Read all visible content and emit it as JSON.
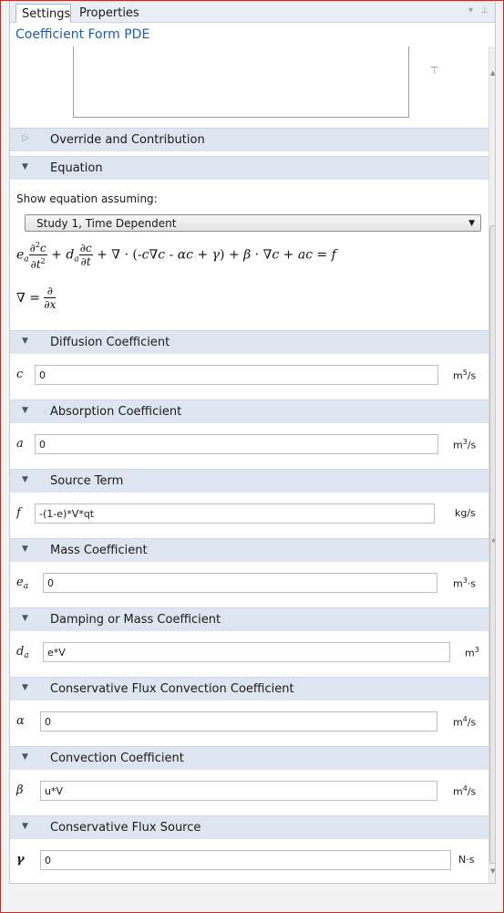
{
  "tabs": [
    {
      "label": "Settings"
    },
    {
      "label": "Properties"
    }
  ],
  "node_title": "Coefficient Form PDE",
  "sections": {
    "override": "Override and Contribution",
    "equation": "Equation",
    "diffusion": "Diffusion Coefficient",
    "absorption": "Absorption Coefficient",
    "source": "Source Term",
    "mass": "Mass Coefficient",
    "damping": "Damping or Mass Coefficient",
    "cflux_conv": "Conservative Flux Convection Coefficient",
    "convection": "Convection Coefficient",
    "cflux_source": "Conservative Flux Source"
  },
  "equation": {
    "show_label": "Show equation assuming:",
    "study_selected": "Study 1, Time Dependent"
  },
  "fields": {
    "c": {
      "symbol": "c",
      "value": "0",
      "unit": "m",
      "unit_sup": "5",
      "unit_tail": "/s"
    },
    "a": {
      "symbol": "a",
      "value": "0",
      "unit": "m",
      "unit_sup": "3",
      "unit_tail": "/s"
    },
    "f": {
      "symbol": "f",
      "value": "-(1-e)*V*qt",
      "unit": "kg/s",
      "unit_sup": "",
      "unit_tail": ""
    },
    "ea": {
      "symbol": "e",
      "sub": "a",
      "value": "0",
      "unit": "m",
      "unit_sup": "3",
      "unit_tail": "·s"
    },
    "da": {
      "symbol": "d",
      "sub": "a",
      "value": "e*V",
      "unit": "m",
      "unit_sup": "3",
      "unit_tail": ""
    },
    "alpha": {
      "symbol": "α",
      "value": "0",
      "unit": "m",
      "unit_sup": "4",
      "unit_tail": "/s"
    },
    "beta": {
      "symbol": "β",
      "value": "u*V",
      "unit": "m",
      "unit_sup": "4",
      "unit_tail": "/s"
    },
    "gamma": {
      "symbol": "γ",
      "value": "0",
      "unit": "N·s",
      "unit_sup": "",
      "unit_tail": ""
    }
  },
  "icons": [
    "pin-icon",
    "dropdown-caret-icon",
    "section-expanded-icon",
    "section-collapsed-icon",
    "scroll-up-icon",
    "scroll-down-icon"
  ]
}
